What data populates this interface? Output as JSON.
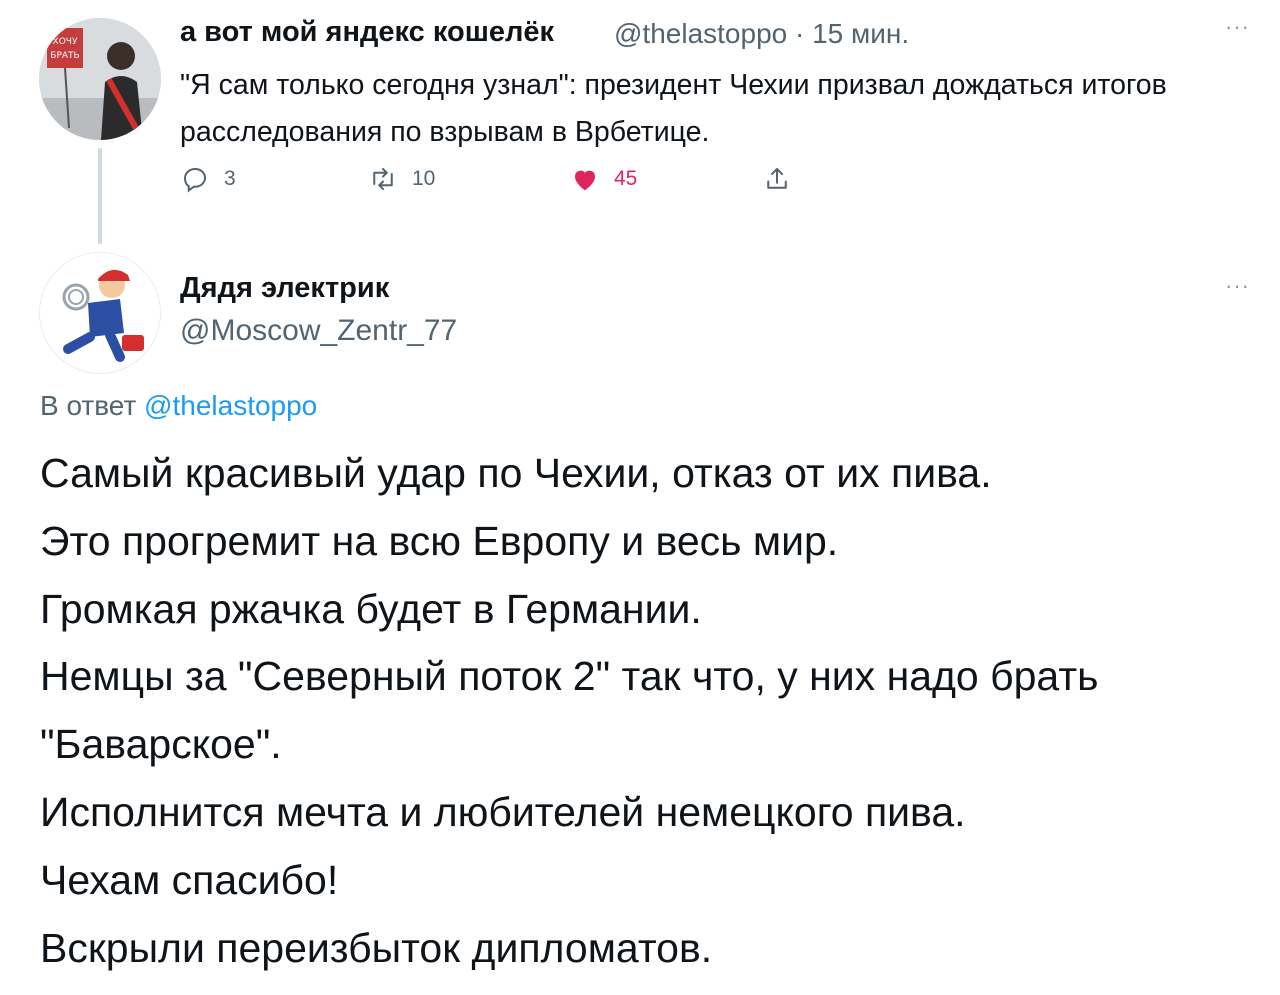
{
  "parent_tweet": {
    "author_name": "а вот мой яндекс кошелёк",
    "handle": "@thelastoppo",
    "time": "· 15 мин.",
    "text": "\"Я сам только сегодня узнал\": президент Чехии призвал дождаться итогов расследования по взрывам в Врбетице.",
    "more": "···",
    "actions": {
      "reply_count": "3",
      "retweet_count": "10",
      "like_count": "45"
    },
    "avatar_sign_text": "ХОЧУ БРАТЬ"
  },
  "reply_tweet": {
    "author_name": "Дядя электрик",
    "handle": "@Moscow_Zentr_77",
    "more": "···",
    "reply_prefix": "В ответ",
    "reply_mention": "@thelastoppo",
    "lines": [
      "Самый красивый удар по Чехии, отказ от их пива.",
      "Это прогремит на всю Европу и весь мир.",
      "Громкая ржачка будет в Германии.",
      "Немцы за \"Северный поток 2\" так что, у них надо брать",
      "\"Баварское\".",
      "Исполнится мечта  и любителей немецкого пива.",
      "Чехам спасибо!",
      "Вскрыли переизбыток дипломатов."
    ]
  },
  "colors": {
    "text": "#0f1419",
    "secondary": "#536471",
    "accent": "#1d9bf0",
    "like": "#e0245e"
  },
  "icons": [
    "reply-icon",
    "retweet-icon",
    "heart-icon",
    "share-icon",
    "more-icon"
  ]
}
